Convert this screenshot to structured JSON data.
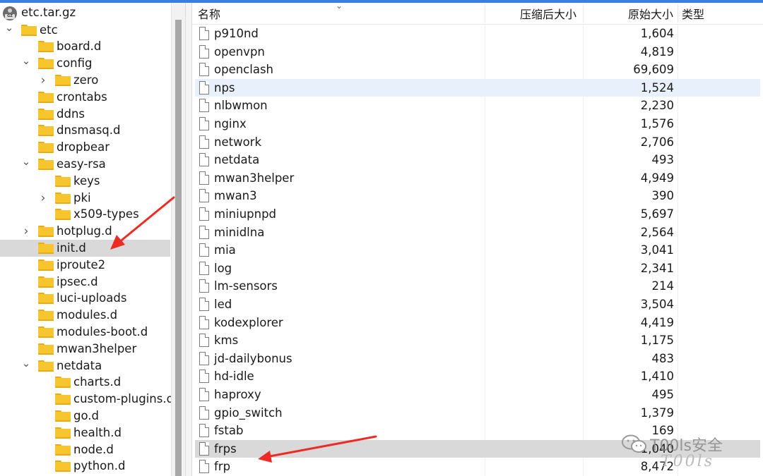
{
  "tree": {
    "root_label": "etc.tar.gz",
    "root_icon": "archive-gz-icon",
    "items": [
      {
        "label": "etc",
        "depth": 0,
        "expander": "expanded"
      },
      {
        "label": "board.d",
        "depth": 1,
        "expander": "none"
      },
      {
        "label": "config",
        "depth": 1,
        "expander": "expanded"
      },
      {
        "label": "zero",
        "depth": 2,
        "expander": "collapsed"
      },
      {
        "label": "crontabs",
        "depth": 1,
        "expander": "none"
      },
      {
        "label": "ddns",
        "depth": 1,
        "expander": "none"
      },
      {
        "label": "dnsmasq.d",
        "depth": 1,
        "expander": "none"
      },
      {
        "label": "dropbear",
        "depth": 1,
        "expander": "none"
      },
      {
        "label": "easy-rsa",
        "depth": 1,
        "expander": "expanded"
      },
      {
        "label": "keys",
        "depth": 2,
        "expander": "none"
      },
      {
        "label": "pki",
        "depth": 2,
        "expander": "collapsed"
      },
      {
        "label": "x509-types",
        "depth": 2,
        "expander": "none"
      },
      {
        "label": "hotplug.d",
        "depth": 1,
        "expander": "collapsed"
      },
      {
        "label": "init.d",
        "depth": 1,
        "expander": "none",
        "selected": true
      },
      {
        "label": "iproute2",
        "depth": 1,
        "expander": "none"
      },
      {
        "label": "ipsec.d",
        "depth": 1,
        "expander": "none"
      },
      {
        "label": "luci-uploads",
        "depth": 1,
        "expander": "none"
      },
      {
        "label": "modules.d",
        "depth": 1,
        "expander": "none"
      },
      {
        "label": "modules-boot.d",
        "depth": 1,
        "expander": "none"
      },
      {
        "label": "mwan3helper",
        "depth": 1,
        "expander": "none"
      },
      {
        "label": "netdata",
        "depth": 1,
        "expander": "expanded"
      },
      {
        "label": "charts.d",
        "depth": 2,
        "expander": "none"
      },
      {
        "label": "custom-plugins.d",
        "depth": 2,
        "expander": "none"
      },
      {
        "label": "go.d",
        "depth": 2,
        "expander": "none"
      },
      {
        "label": "health.d",
        "depth": 2,
        "expander": "none"
      },
      {
        "label": "node.d",
        "depth": 2,
        "expander": "none"
      },
      {
        "label": "python.d",
        "depth": 2,
        "expander": "none"
      }
    ]
  },
  "list": {
    "columns": {
      "name": "名称",
      "compressed": "压缩后大小",
      "original": "原始大小",
      "type": "类型"
    },
    "rows": [
      {
        "name": "p910nd",
        "size": "1,604"
      },
      {
        "name": "openvpn",
        "size": "4,819"
      },
      {
        "name": "openclash",
        "size": "69,609"
      },
      {
        "name": "nps",
        "size": "1,524",
        "state": "hover"
      },
      {
        "name": "nlbwmon",
        "size": "2,230"
      },
      {
        "name": "nginx",
        "size": "1,576"
      },
      {
        "name": "network",
        "size": "2,706"
      },
      {
        "name": "netdata",
        "size": "493"
      },
      {
        "name": "mwan3helper",
        "size": "4,949"
      },
      {
        "name": "mwan3",
        "size": "390"
      },
      {
        "name": "miniupnpd",
        "size": "5,697"
      },
      {
        "name": "minidlna",
        "size": "2,564"
      },
      {
        "name": "mia",
        "size": "3,041"
      },
      {
        "name": "log",
        "size": "2,341"
      },
      {
        "name": "lm-sensors",
        "size": "214"
      },
      {
        "name": "led",
        "size": "3,504"
      },
      {
        "name": "kodexplorer",
        "size": "4,419"
      },
      {
        "name": "kms",
        "size": "1,175"
      },
      {
        "name": "jd-dailybonus",
        "size": "483"
      },
      {
        "name": "hd-idle",
        "size": "1,410"
      },
      {
        "name": "haproxy",
        "size": "495"
      },
      {
        "name": "gpio_switch",
        "size": "1,379"
      },
      {
        "name": "fstab",
        "size": "169"
      },
      {
        "name": "frps",
        "size": "1,040",
        "state": "selected"
      },
      {
        "name": "frp",
        "size": "8,472"
      }
    ]
  },
  "watermark": {
    "text": "T00ls安全",
    "script": "T00ls"
  },
  "colors": {
    "accent": "#3b7de0",
    "folder": "#f7c62f",
    "selection": "#d9d9d9",
    "hover": "#e8f1fb",
    "annotation_arrow": "#ee2a24"
  }
}
